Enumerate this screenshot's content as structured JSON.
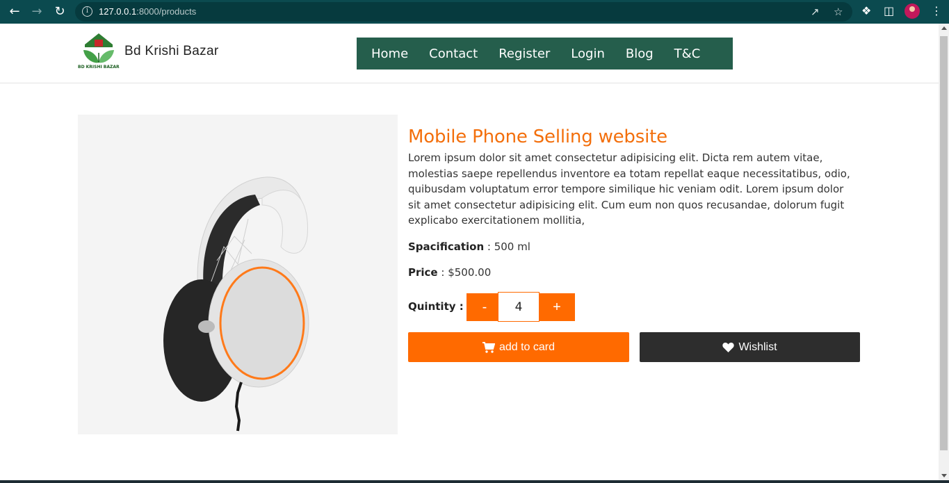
{
  "browser": {
    "url_host": "127.0.0.1",
    "url_rest": ":8000/products"
  },
  "site": {
    "brand": "Bd Krishi Bazar",
    "logo_caption": "BD KRISHI BAZAR",
    "nav": [
      "Home",
      "Contact",
      "Register",
      "Login",
      "Blog",
      "T&C"
    ]
  },
  "product": {
    "title": "Mobile Phone Selling website",
    "description": "Lorem ipsum dolor sit amet consectetur adipisicing elit. Dicta rem autem vitae, molestias saepe repellendus inventore ea totam repellat eaque necessitatibus, odio, quibusdam voluptatum error tempore similique hic veniam odit. Lorem ipsum dolor sit amet consectetur adipisicing elit. Cum eum non quos recusandae, dolorum fugit explicabo exercitationem mollitia,",
    "spec_label": "Spacification",
    "spec_value": "500 ml",
    "price_label": "Price",
    "price_value": "$500.00",
    "qty_label": "Quintity :",
    "qty_value": "4",
    "minus": "-",
    "plus": "+",
    "add_to_cart": "add to card",
    "wishlist": "Wishlist"
  },
  "colors": {
    "accent": "#ff6a00",
    "title": "#f36f0c",
    "nav_bg": "#255e4c",
    "wishlist_bg": "#2d2d2d"
  }
}
